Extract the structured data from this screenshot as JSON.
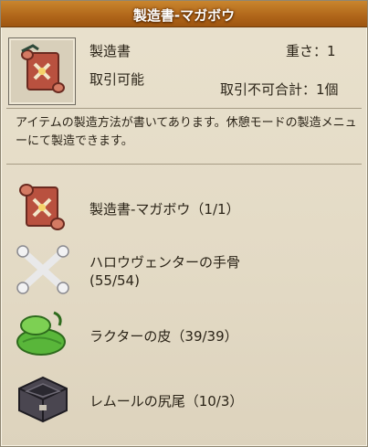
{
  "window": {
    "title": "製造書-マガボウ"
  },
  "item": {
    "name": "製造書",
    "weight": "重さ：1",
    "trade": "取引可能",
    "untradeable_total": "取引不可合計：1個",
    "icon": "recipe-scroll-icon"
  },
  "description": "アイテムの製造方法が書いてあります。休憩モードの製造メニューにて製造できます。",
  "materials": [
    {
      "icon": "recipe-scroll-icon",
      "label": "製造書-マガボウ（1/1）"
    },
    {
      "icon": "crossed-bones-icon",
      "label": "ハロウヴェンターの手骨",
      "count": "(55/54)"
    },
    {
      "icon": "green-hide-icon",
      "label": "ラクターの皮（39/39）"
    },
    {
      "icon": "dark-chest-icon",
      "label": "レムールの尻尾（10/3）"
    }
  ],
  "colors": {
    "title_bar": "#b2681b",
    "panel_bg": "#e6dec9",
    "text": "#2b2418"
  }
}
